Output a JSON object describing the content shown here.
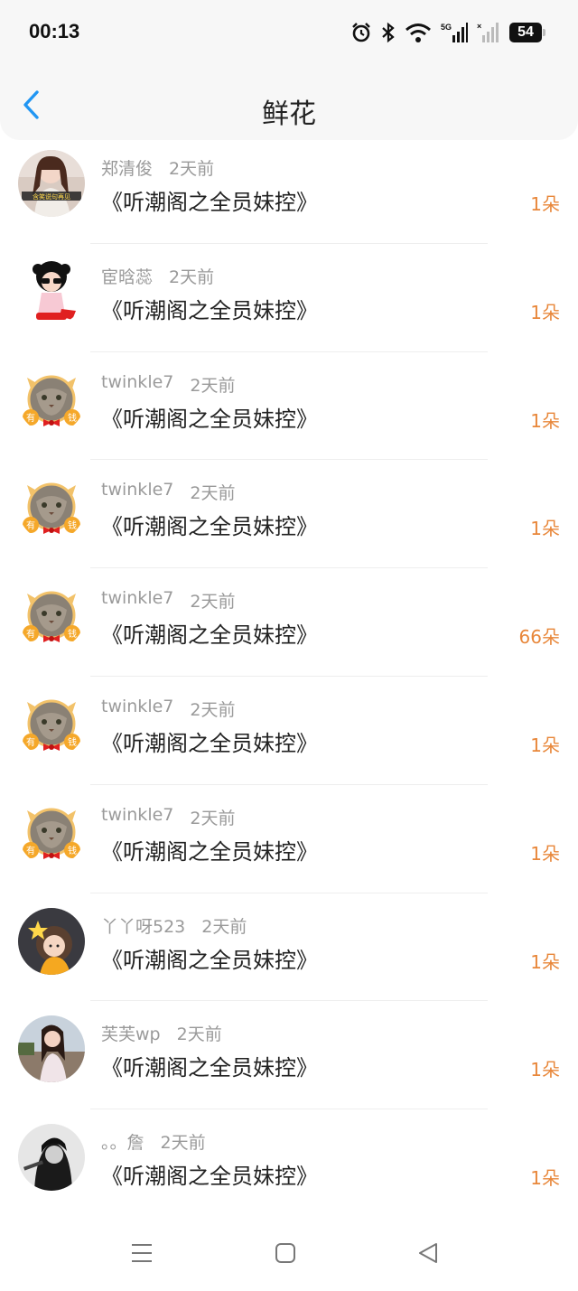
{
  "status_bar": {
    "time": "00:13",
    "icons": [
      "alarm-icon",
      "bluetooth-icon",
      "wifi-icon",
      "signal-5g-icon",
      "signal-icon"
    ],
    "battery": "54"
  },
  "header": {
    "title": "鲜花",
    "back_icon": "chevron-left-icon",
    "accent_color": "#2196f3"
  },
  "list": [
    {
      "user": "郑清俊",
      "time": "2天前",
      "book": "《听潮阁之全员妹控》",
      "count": "1朵",
      "avatar": "girl-photo-caption"
    },
    {
      "user": "宦晗蕊",
      "time": "2天前",
      "book": "《听潮阁之全员妹控》",
      "count": "1朵",
      "avatar": "cartoon-sunglasses"
    },
    {
      "user": "twinkle7",
      "time": "2天前",
      "book": "《听潮阁之全员妹控》",
      "count": "1朵",
      "avatar": "cat-rich"
    },
    {
      "user": "twinkle7",
      "time": "2天前",
      "book": "《听潮阁之全员妹控》",
      "count": "1朵",
      "avatar": "cat-rich"
    },
    {
      "user": "twinkle7",
      "time": "2天前",
      "book": "《听潮阁之全员妹控》",
      "count": "66朵",
      "avatar": "cat-rich"
    },
    {
      "user": "twinkle7",
      "time": "2天前",
      "book": "《听潮阁之全员妹控》",
      "count": "1朵",
      "avatar": "cat-rich"
    },
    {
      "user": "twinkle7",
      "time": "2天前",
      "book": "《听潮阁之全员妹控》",
      "count": "1朵",
      "avatar": "cat-rich"
    },
    {
      "user": "丫丫呀523",
      "time": "2天前",
      "book": "《听潮阁之全员妹控》",
      "count": "1朵",
      "avatar": "girl-star"
    },
    {
      "user": "芙芙wp",
      "time": "2天前",
      "book": "《听潮阁之全员妹控》",
      "count": "1朵",
      "avatar": "girl-photo"
    },
    {
      "user": "。。詹",
      "time": "2天前",
      "book": "《听潮阁之全员妹控》",
      "count": "1朵",
      "avatar": "bw-photo"
    }
  ],
  "count_color": "#e8873a",
  "nav_bar": {
    "icons": [
      "menu-icon",
      "home-square-icon",
      "back-triangle-icon"
    ]
  }
}
